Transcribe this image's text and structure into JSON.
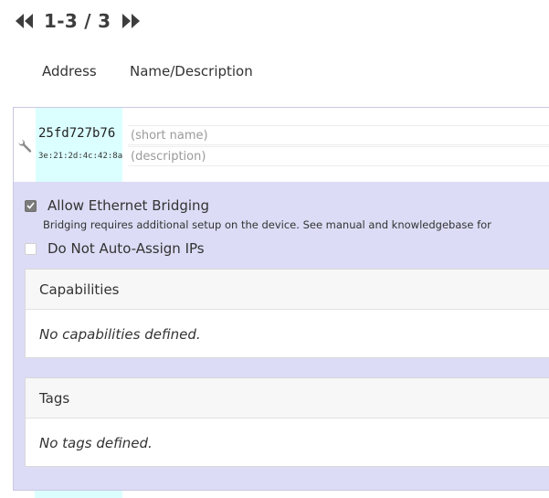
{
  "pager": {
    "range_text": "1-3 / 3",
    "prev_icon": "double-chevron-left-icon",
    "next_icon": "double-chevron-right-icon"
  },
  "columns": {
    "address": "Address",
    "name_description": "Name/Description"
  },
  "member": {
    "settings_icon": "wrench-icon",
    "node_id": "25fd727b76",
    "mac_address": "3e:21:2d:4c:42:8a",
    "name_value": "",
    "name_placeholder": "(short name)",
    "description_value": "",
    "description_placeholder": "(description)",
    "allow_bridging": {
      "checked": true,
      "label": "Allow Ethernet Bridging",
      "note": "Bridging requires additional setup on the device. See manual and knowledgebase for"
    },
    "no_auto_assign": {
      "checked": false,
      "label": "Do Not Auto-Assign IPs"
    },
    "capabilities": {
      "title": "Capabilities",
      "empty_text": "No capabilities defined."
    },
    "tags": {
      "title": "Tags",
      "empty_text": "No tags defined."
    }
  },
  "colors": {
    "panel_background": "#dcdcf6",
    "address_highlight": "#dbffff",
    "checkbox_checked": "#7b7b7b",
    "text": "#333333"
  }
}
